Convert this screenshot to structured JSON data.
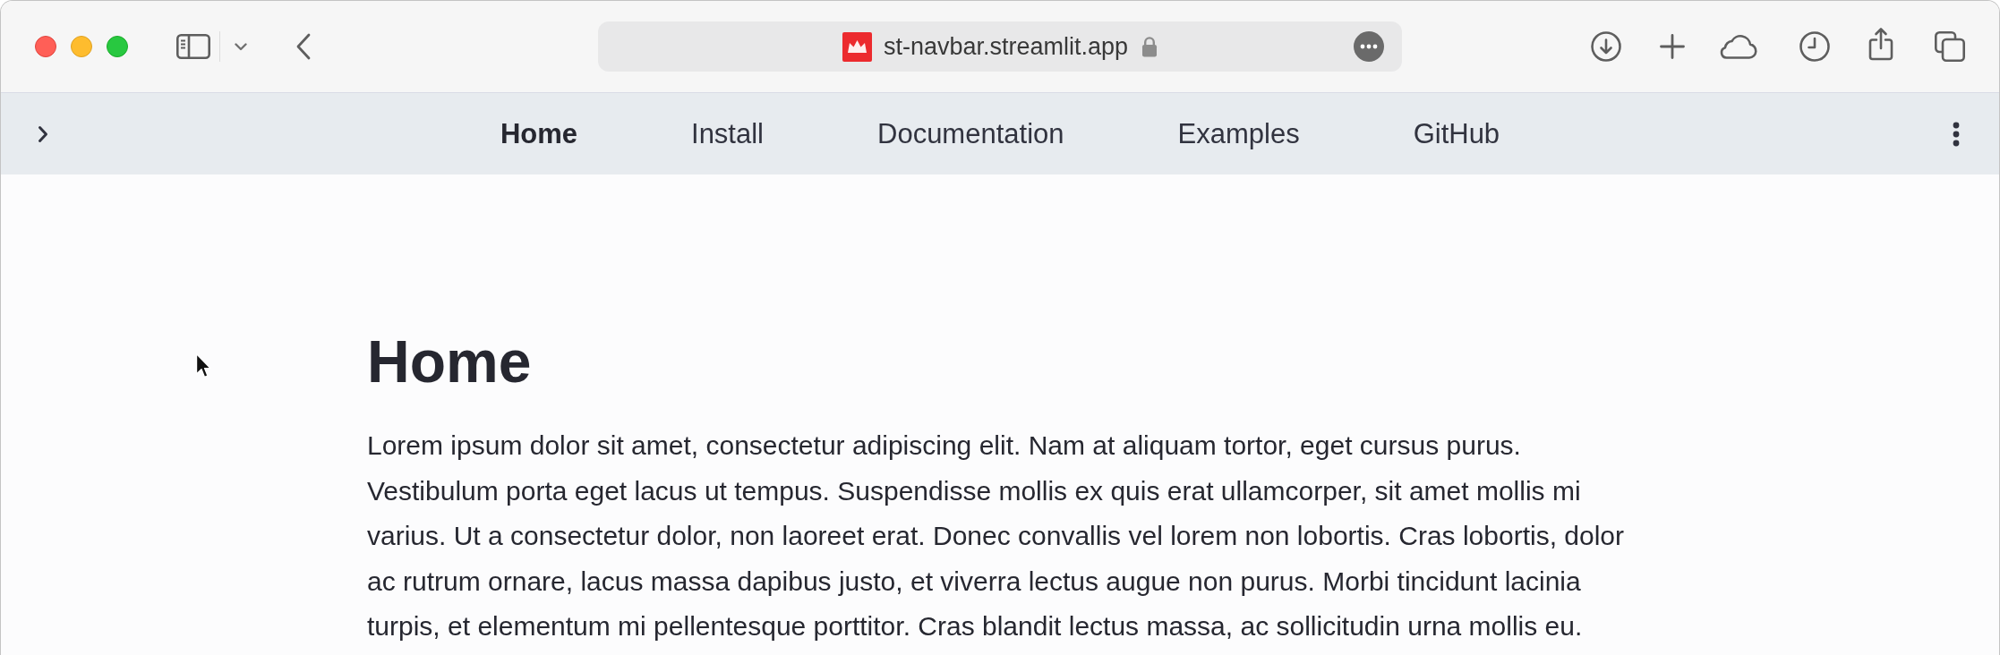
{
  "browser": {
    "address": "st-navbar.streamlit.app"
  },
  "navbar": {
    "items": [
      {
        "label": "Home",
        "selected": true
      },
      {
        "label": "Install",
        "selected": false
      },
      {
        "label": "Documentation",
        "selected": false
      },
      {
        "label": "Examples",
        "selected": false
      },
      {
        "label": "GitHub",
        "selected": false
      }
    ]
  },
  "page": {
    "heading": "Home",
    "paragraph": "Lorem ipsum dolor sit amet, consectetur adipiscing elit. Nam at aliquam tortor, eget cursus purus. Vestibulum porta eget lacus ut tempus. Suspendisse mollis ex quis erat ullamcorper, sit amet mollis mi varius. Ut a consectetur dolor, non laoreet erat. Donec convallis vel lorem non lobortis. Cras lobortis, dolor ac rutrum ornare, lacus massa dapibus justo, et viverra lectus augue non purus. Morbi tincidunt lacinia turpis, et elementum mi pellentesque porttitor. Cras blandit lectus massa, ac sollicitudin urna mollis eu."
  }
}
